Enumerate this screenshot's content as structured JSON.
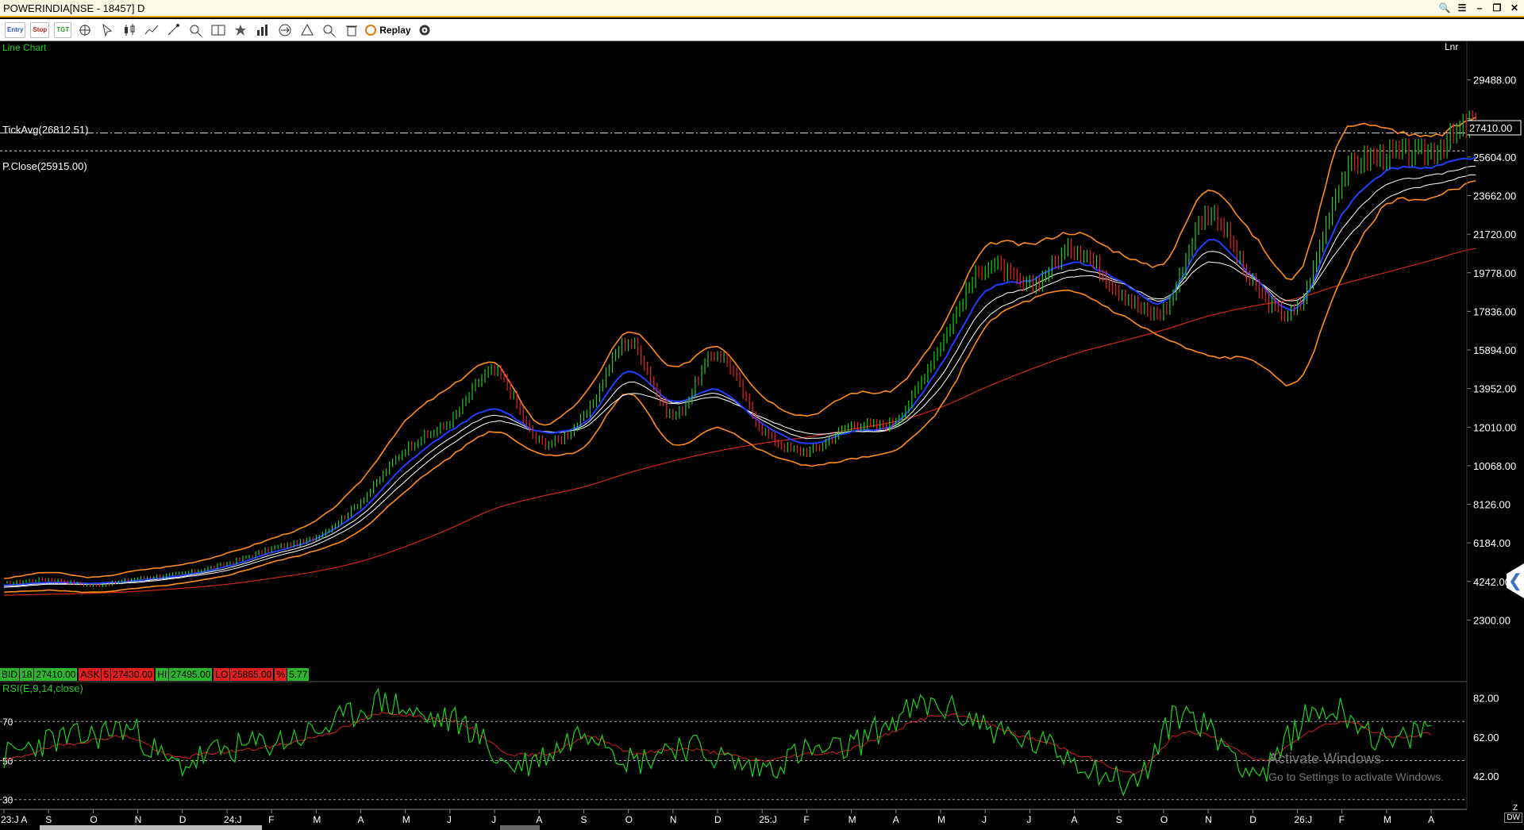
{
  "window": {
    "title": "POWERINDIA[NSE - 18457] D",
    "controls": [
      "search",
      "menu",
      "minimize",
      "restore",
      "close"
    ]
  },
  "toolbar": {
    "entry_label": "Entry",
    "stop_label": "Stop",
    "target_label": "TGT",
    "replay_label": "Replay"
  },
  "chart_header": {
    "chart_type_label": "Line Chart",
    "scale_label": "Lnr"
  },
  "reference_lines": {
    "tick_avg_label": "TickAvg(26812.51)",
    "tick_avg_value": 26812.51,
    "prev_close_label": "P.Close(25915.00)",
    "prev_close_value": 25915.0,
    "last_price_label": "27410.00",
    "last_price_value": 27410.0
  },
  "quote_bar": {
    "bid_label": "BID",
    "bid_qty": "18",
    "bid_price": "27410.00",
    "ask_label": "ASK",
    "ask_qty": "5",
    "ask_price": "27430.00",
    "hi_label": "HI",
    "hi_value": "27495.00",
    "lo_label": "LO",
    "lo_value": "25865.00",
    "pct_label": "%",
    "pct_value": "5.77"
  },
  "rsi_label": "RSI(E,9,14,close)",
  "colors": {
    "price_up": "#22cc22",
    "price_down": "#ee2222",
    "bollinger": "#ff8c1a",
    "ema_fast": "#1f3fff",
    "ema_slow": "#ffffff",
    "sma_long": "#cc2a10",
    "rsi_line": "#20d020",
    "rsi_signal": "#d02020"
  },
  "watermark": {
    "title": "Activate Windows",
    "subtitle": "Go to Settings to activate Windows."
  },
  "dw_label": "DW",
  "z_label": "Z",
  "chart_data": {
    "type": "line",
    "price_y_ticks": [
      29488.0,
      27546.0,
      25604.0,
      23662.0,
      21720.0,
      19778.0,
      17836.0,
      15894.0,
      13952.0,
      12010.0,
      10068.0,
      8126.0,
      6184.0,
      4242.0,
      2300.0
    ],
    "price_y_tick_labels": [
      "29488.00",
      "",
      "25604.00",
      "23662.00",
      "21720.00",
      "19778.00",
      "17836.00",
      "15894.00",
      "13952.00",
      "12010.00",
      "10068.00",
      "8126.00",
      "6184.00",
      "4242.00",
      "2300.00"
    ],
    "price_ylim": [
      280,
      31430
    ],
    "rsi_y_ticks_right": [
      "82.00",
      "62.00",
      "42.00"
    ],
    "rsi_y_tick_values": [
      82,
      62,
      42
    ],
    "rsi_y_ticks_left": [
      "70",
      "50",
      "30"
    ],
    "rsi_y_left_values": [
      70,
      50,
      30
    ],
    "rsi_ylim": [
      25,
      90
    ],
    "x_labels": [
      "23:J A",
      "S",
      "O",
      "N",
      "D",
      "24:J",
      "F",
      "M",
      "A",
      "M",
      "J",
      "J",
      "A",
      "S",
      "O",
      "N",
      "D",
      "25:J",
      "F",
      "M",
      "A",
      "M",
      "J",
      "J",
      "A",
      "S",
      "O",
      "N",
      "D",
      "26:J",
      "F",
      "M",
      "A"
    ],
    "x_month_index": [
      0,
      1,
      2,
      3,
      4,
      5,
      6,
      7,
      8,
      9,
      10,
      11,
      12,
      13,
      14,
      15,
      16,
      17,
      18,
      19,
      20,
      21,
      22,
      23,
      24,
      25,
      26,
      27,
      28,
      29,
      30,
      31,
      32
    ],
    "price_months": [
      0,
      1,
      2,
      3,
      4,
      5,
      6,
      7,
      8,
      9,
      10,
      11,
      12,
      13,
      14,
      15,
      16,
      17,
      18,
      19,
      20,
      21,
      22,
      23,
      24,
      25,
      26,
      27,
      28,
      29,
      30,
      31,
      32,
      33
    ],
    "series": [
      {
        "name": "Close",
        "values": [
          4150,
          4350,
          4050,
          4400,
          4650,
          5150,
          5900,
          6500,
          8300,
          10900,
          12300,
          14800,
          11300,
          12500,
          16300,
          12600,
          15700,
          11900,
          10800,
          12100,
          12400,
          16200,
          20100,
          19100,
          21000,
          18900,
          17900,
          22800,
          19200,
          18000,
          24500,
          25700,
          25900,
          27410
        ]
      }
    ],
    "bollinger_upper": [
      4400,
      4700,
      4450,
      4800,
      5100,
      5650,
      6400,
      7300,
      9300,
      12300,
      14000,
      15200,
      12200,
      13600,
      16800,
      15000,
      16100,
      13600,
      12600,
      13700,
      14000,
      16900,
      21000,
      21200,
      21800,
      20800,
      20300,
      24000,
      21700,
      19700,
      26700,
      27000,
      26600,
      27600
    ],
    "bollinger_lower": [
      3700,
      3800,
      3700,
      3900,
      4150,
      4550,
      5200,
      5800,
      6800,
      8800,
      10500,
      11800,
      10700,
      11000,
      13700,
      11100,
      12000,
      10800,
      10100,
      10400,
      10900,
      13000,
      17000,
      18400,
      18800,
      17700,
      16500,
      15600,
      15400,
      14300,
      19600,
      23200,
      23500,
      24400
    ],
    "ema_fast": [
      4050,
      4200,
      4150,
      4300,
      4550,
      5000,
      5700,
      6400,
      7800,
      10100,
      11800,
      12900,
      11800,
      12200,
      14800,
      13300,
      13900,
      12200,
      11200,
      11800,
      12200,
      15100,
      18800,
      19400,
      20300,
      19400,
      18300,
      21400,
      19600,
      18000,
      22700,
      24900,
      25100,
      25600
    ],
    "ema_slow": [
      3950,
      4100,
      4100,
      4200,
      4450,
      4800,
      5450,
      6100,
      7300,
      9300,
      11100,
      12300,
      11800,
      12000,
      13700,
      13200,
      13500,
      12500,
      11700,
      11800,
      12000,
      14000,
      17400,
      18700,
      19600,
      19300,
      18500,
      20300,
      19500,
      18400,
      21200,
      23500,
      24200,
      24700
    ],
    "sma_long": [
      3550,
      3600,
      3650,
      3750,
      3900,
      4100,
      4400,
      4750,
      5250,
      6000,
      6900,
      7900,
      8500,
      9000,
      9700,
      10300,
      10800,
      11200,
      11500,
      11900,
      12300,
      13000,
      14000,
      14900,
      15700,
      16300,
      16900,
      17600,
      18100,
      18500,
      19200,
      19800,
      20400,
      21000
    ],
    "rsi_values": [
      52,
      60,
      62,
      66,
      48,
      54,
      58,
      62,
      70,
      80,
      72,
      68,
      48,
      54,
      66,
      50,
      58,
      52,
      46,
      54,
      56,
      68,
      78,
      72,
      62,
      56,
      46,
      40,
      74,
      60,
      44,
      72,
      74,
      58,
      68
    ],
    "rsi_signal": [
      50,
      56,
      60,
      62,
      52,
      54,
      56,
      60,
      66,
      74,
      72,
      68,
      54,
      54,
      62,
      54,
      56,
      54,
      50,
      53,
      55,
      63,
      72,
      72,
      64,
      58,
      50,
      44,
      64,
      60,
      50,
      64,
      70,
      62,
      64
    ]
  }
}
